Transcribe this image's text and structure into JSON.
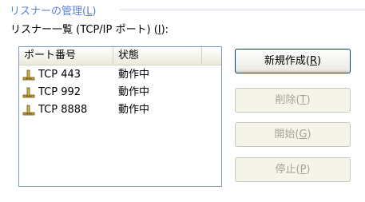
{
  "group": {
    "label": "リスナーの管理(",
    "accel": "L",
    "label_end": ")"
  },
  "list_caption": {
    "label": "リスナー一覧 (TCP/IP ポート) (",
    "accel": "I",
    "label_end": "):"
  },
  "listview": {
    "columns": [
      "ポート番号",
      "状態",
      ""
    ],
    "rows": [
      {
        "name": "TCP 443",
        "state": "動作中",
        "icon": "connector-icon"
      },
      {
        "name": "TCP 992",
        "state": "動作中",
        "icon": "connector-icon"
      },
      {
        "name": "TCP 8888",
        "state": "動作中",
        "icon": "connector-icon"
      }
    ]
  },
  "buttons": {
    "new": {
      "label": "新規作成(",
      "accel": "R",
      "end": ")",
      "enabled": true
    },
    "delete": {
      "label": "削除(",
      "accel": "T",
      "end": ")",
      "enabled": false
    },
    "start": {
      "label": "開始(",
      "accel": "G",
      "end": ")",
      "enabled": false
    },
    "stop": {
      "label": "停止(",
      "accel": "P",
      "end": ")",
      "enabled": false
    }
  },
  "colors": {
    "group_label": "#5f7fd6",
    "listview_border": "#7f9db9",
    "button_border": "#003c74",
    "disabled_text": "#a6a594"
  }
}
